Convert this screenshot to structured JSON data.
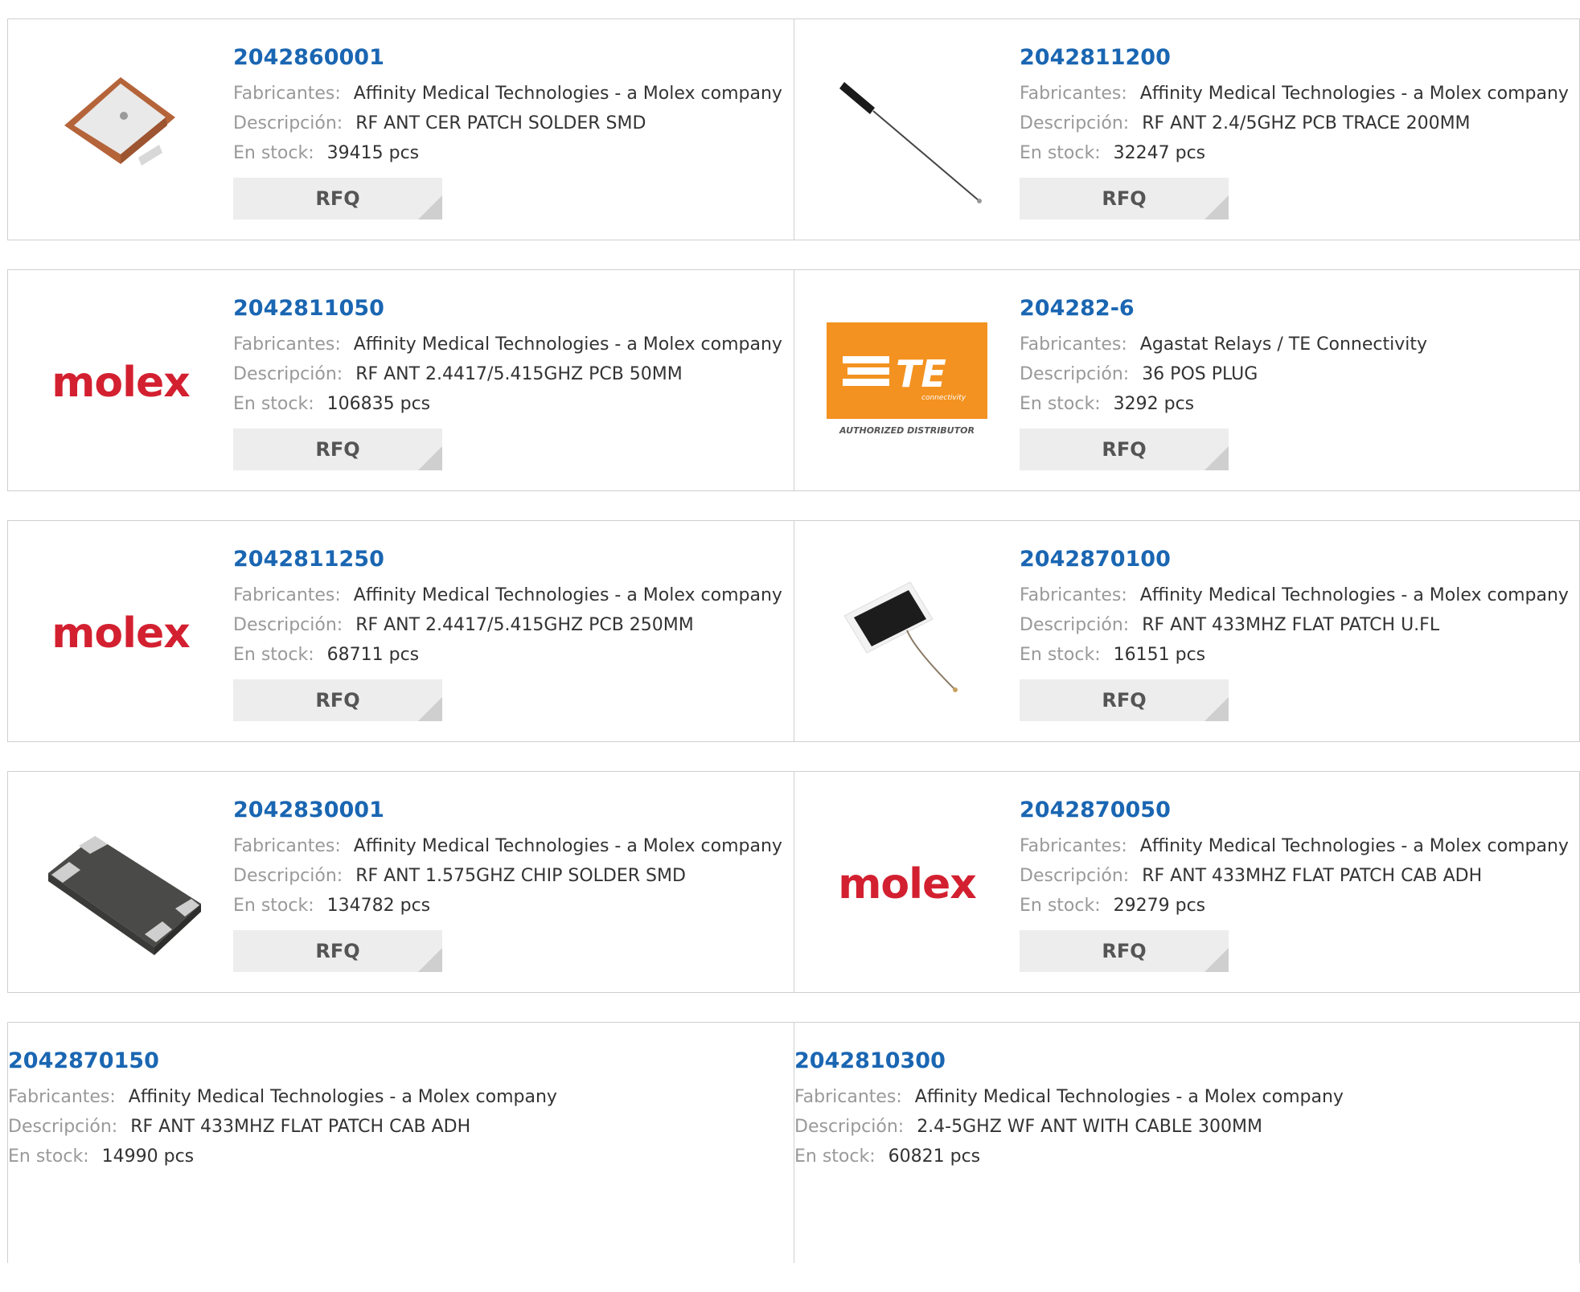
{
  "labels": {
    "manufacturer": "Fabricantes:",
    "description": "Descripción:",
    "stock": "En stock:",
    "rfq": "RFQ"
  },
  "logos": {
    "molex": "molex",
    "te": "TE",
    "te_sub": "connectivity",
    "te_auth": "AUTHORIZED DISTRIBUTOR"
  },
  "products": [
    {
      "part": "2042860001",
      "manufacturer": "Affinity Medical Technologies - a Molex company",
      "description": "RF ANT CER PATCH SOLDER SMD",
      "stock": "39415 pcs",
      "image": "ceramic-patch-antenna"
    },
    {
      "part": "2042811200",
      "manufacturer": "Affinity Medical Technologies - a Molex company",
      "description": "RF ANT 2.4/5GHZ PCB TRACE 200MM",
      "stock": "32247 pcs",
      "image": "pcb-trace-antenna"
    },
    {
      "part": "2042811050",
      "manufacturer": "Affinity Medical Technologies - a Molex company",
      "description": "RF ANT 2.4417/5.415GHZ PCB 50MM",
      "stock": "106835 pcs",
      "image": "molex-logo"
    },
    {
      "part": "204282-6",
      "manufacturer": "Agastat Relays / TE Connectivity",
      "description": "36 POS PLUG",
      "stock": "3292 pcs",
      "image": "te-logo"
    },
    {
      "part": "2042811250",
      "manufacturer": "Affinity Medical Technologies - a Molex company",
      "description": "RF ANT 2.4417/5.415GHZ PCB 250MM",
      "stock": "68711 pcs",
      "image": "molex-logo"
    },
    {
      "part": "2042870100",
      "manufacturer": "Affinity Medical Technologies - a Molex company",
      "description": "RF ANT 433MHZ FLAT PATCH U.FL",
      "stock": "16151 pcs",
      "image": "flat-patch-antenna"
    },
    {
      "part": "2042830001",
      "manufacturer": "Affinity Medical Technologies - a Molex company",
      "description": "RF ANT 1.575GHZ CHIP SOLDER SMD",
      "stock": "134782 pcs",
      "image": "chip-antenna"
    },
    {
      "part": "2042870050",
      "manufacturer": "Affinity Medical Technologies - a Molex company",
      "description": "RF ANT 433MHZ FLAT PATCH CAB ADH",
      "stock": "29279 pcs",
      "image": "molex-logo"
    },
    {
      "part": "2042870150",
      "manufacturer": "Affinity Medical Technologies - a Molex company",
      "description": "RF ANT 433MHZ FLAT PATCH CAB ADH",
      "stock": "14990 pcs",
      "image": "none"
    },
    {
      "part": "2042810300",
      "manufacturer": "Affinity Medical Technologies - a Molex company",
      "description": "2.4-5GHZ WF ANT WITH CABLE 300MM",
      "stock": "60821 pcs",
      "image": "none"
    }
  ]
}
